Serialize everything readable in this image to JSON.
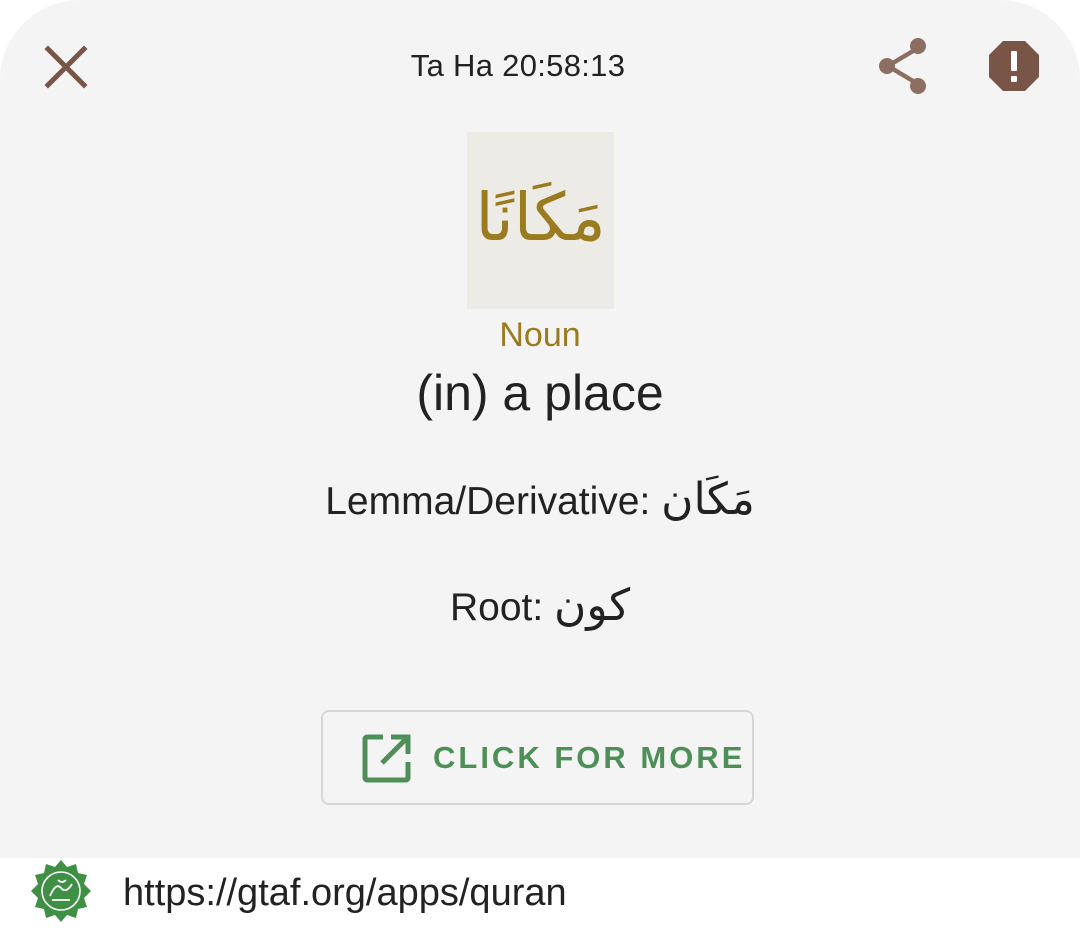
{
  "header": {
    "title": "Ta Ha 20:58:13",
    "close_icon": "close-icon",
    "share_icon": "share-icon",
    "report_icon": "report-icon"
  },
  "word": {
    "arabic": "مَكَانًا",
    "part_of_speech": "Noun",
    "meaning": "(in) a place",
    "lemma_label": "Lemma/Derivative:",
    "lemma_value": "مَكَان",
    "root_label": "Root:",
    "root_value": "كون"
  },
  "action": {
    "label": "CLICK FOR MORE",
    "icon": "open-in-new-icon"
  },
  "footer": {
    "url": "https://gtaf.org/apps/quran",
    "logo": "quran-logo"
  },
  "colors": {
    "accent_gold": "#9a7b1f",
    "icon_brown": "#795548",
    "button_green": "#4e8f58",
    "logo_green": "#3f8f45"
  }
}
